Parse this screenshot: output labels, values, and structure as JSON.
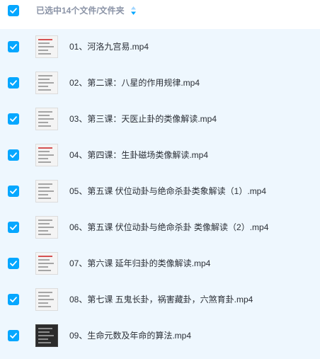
{
  "colors": {
    "accent": "#06a7ff",
    "selected_row_bg": "#eef7fe",
    "header_text": "#8a93a6",
    "row_text": "#2b2f36"
  },
  "header": {
    "select_all_checked": true,
    "selection_label": "已选中14个文件/文件夹",
    "sort_icon": "sort-icon"
  },
  "files": [
    {
      "name": "01、河洛九宫易.mp4",
      "checked": true
    },
    {
      "name": "02、第二课：八星的作用规律.mp4",
      "checked": true
    },
    {
      "name": "03、第三课：天医止卦的类像解读.mp4",
      "checked": true
    },
    {
      "name": "04、第四课：生卦磁场类像解读.mp4",
      "checked": true
    },
    {
      "name": "05、第五课 伏位动卦与绝命杀卦类象解读（1）.mp4",
      "checked": true
    },
    {
      "name": "06、第五课 伏位动卦与绝命杀卦 类像解读（2）.mp4",
      "checked": true
    },
    {
      "name": "07、第六课 延年归卦的类像解读.mp4",
      "checked": true
    },
    {
      "name": "08、第七课 五鬼长卦，祸害藏卦，六煞育卦.mp4",
      "checked": true
    },
    {
      "name": "09、生命元数及年命的算法.mp4",
      "checked": true
    }
  ]
}
